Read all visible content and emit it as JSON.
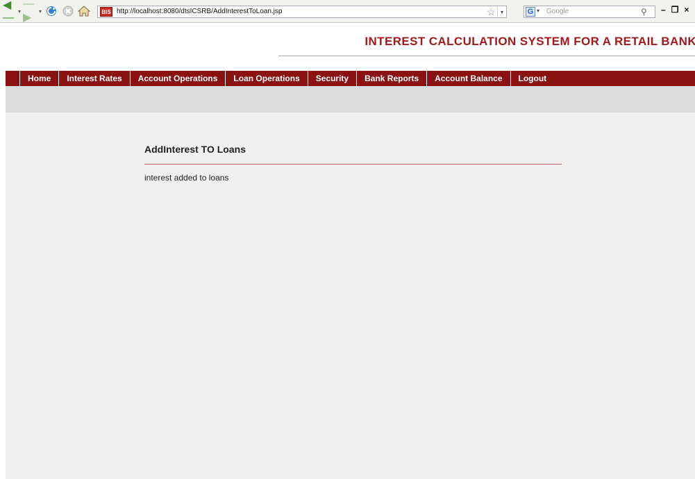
{
  "browser": {
    "url": "http://localhost:8080/dtsICSRB/AddInterestToLoan.jsp",
    "site_icon_text": "BIS",
    "search_placeholder": "Google",
    "search_engine_icon": "G"
  },
  "header": {
    "app_title": "INTEREST CALCULATION SYSTEM FOR A RETAIL BANK"
  },
  "nav": {
    "items": [
      {
        "label": "Home"
      },
      {
        "label": "Interest Rates"
      },
      {
        "label": "Account Operations"
      },
      {
        "label": "Loan Operations"
      },
      {
        "label": "Security"
      },
      {
        "label": "Bank Reports"
      },
      {
        "label": "Account Balance"
      },
      {
        "label": "Logout"
      }
    ]
  },
  "content": {
    "title": "AddInterest TO Loans",
    "message": "interest added to loans"
  },
  "colors": {
    "brand": "#8b1212",
    "title": "#a31919"
  }
}
